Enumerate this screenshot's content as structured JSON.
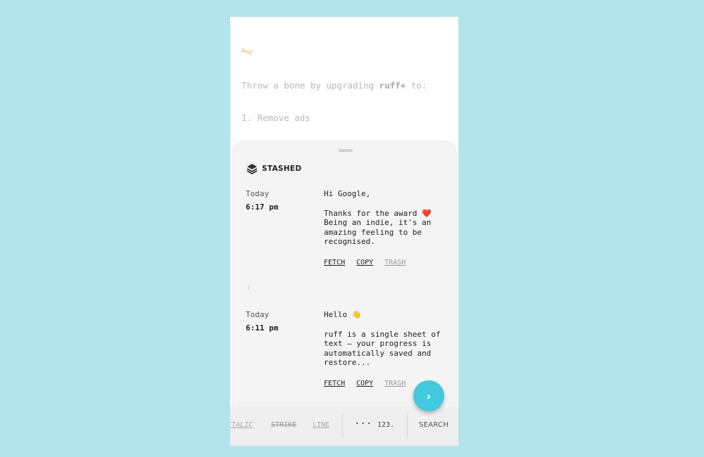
{
  "document": {
    "bone_icon": "bone-icon",
    "line1_prefix": "Throw a bone by upgrading ",
    "line1_bold": "ruff+",
    "line1_suffix": " to:",
    "line2": "1. Remove ads"
  },
  "sheet": {
    "title": "STASHED",
    "icon": "layers-icon",
    "entries": [
      {
        "day": "Today",
        "time": "6:17 pm",
        "greeting": "Hi Google,",
        "message": "Thanks for the award ❤️ Being an indie, it's an amazing feeling to be recognised.",
        "actions": [
          "FETCH",
          "COPY",
          "TRASH"
        ]
      },
      {
        "day": "Today",
        "time": "6:11 pm",
        "greeting": "Hello 👋",
        "message": "ruff is a single sheet of text — your progress is automatically saved and restore...",
        "actions": [
          "FETCH",
          "COPY",
          "TRASH"
        ]
      }
    ]
  },
  "fab": {
    "icon": "chevron-right-icon",
    "glyph": "›"
  },
  "toolbar": {
    "italic": "ITALIC",
    "strike": "STRIKE",
    "line": "LINE",
    "more": "···",
    "numbered": "123.",
    "search": "SEARCH"
  },
  "colors": {
    "background": "#b3e4ec",
    "accent": "#42c9dd"
  }
}
